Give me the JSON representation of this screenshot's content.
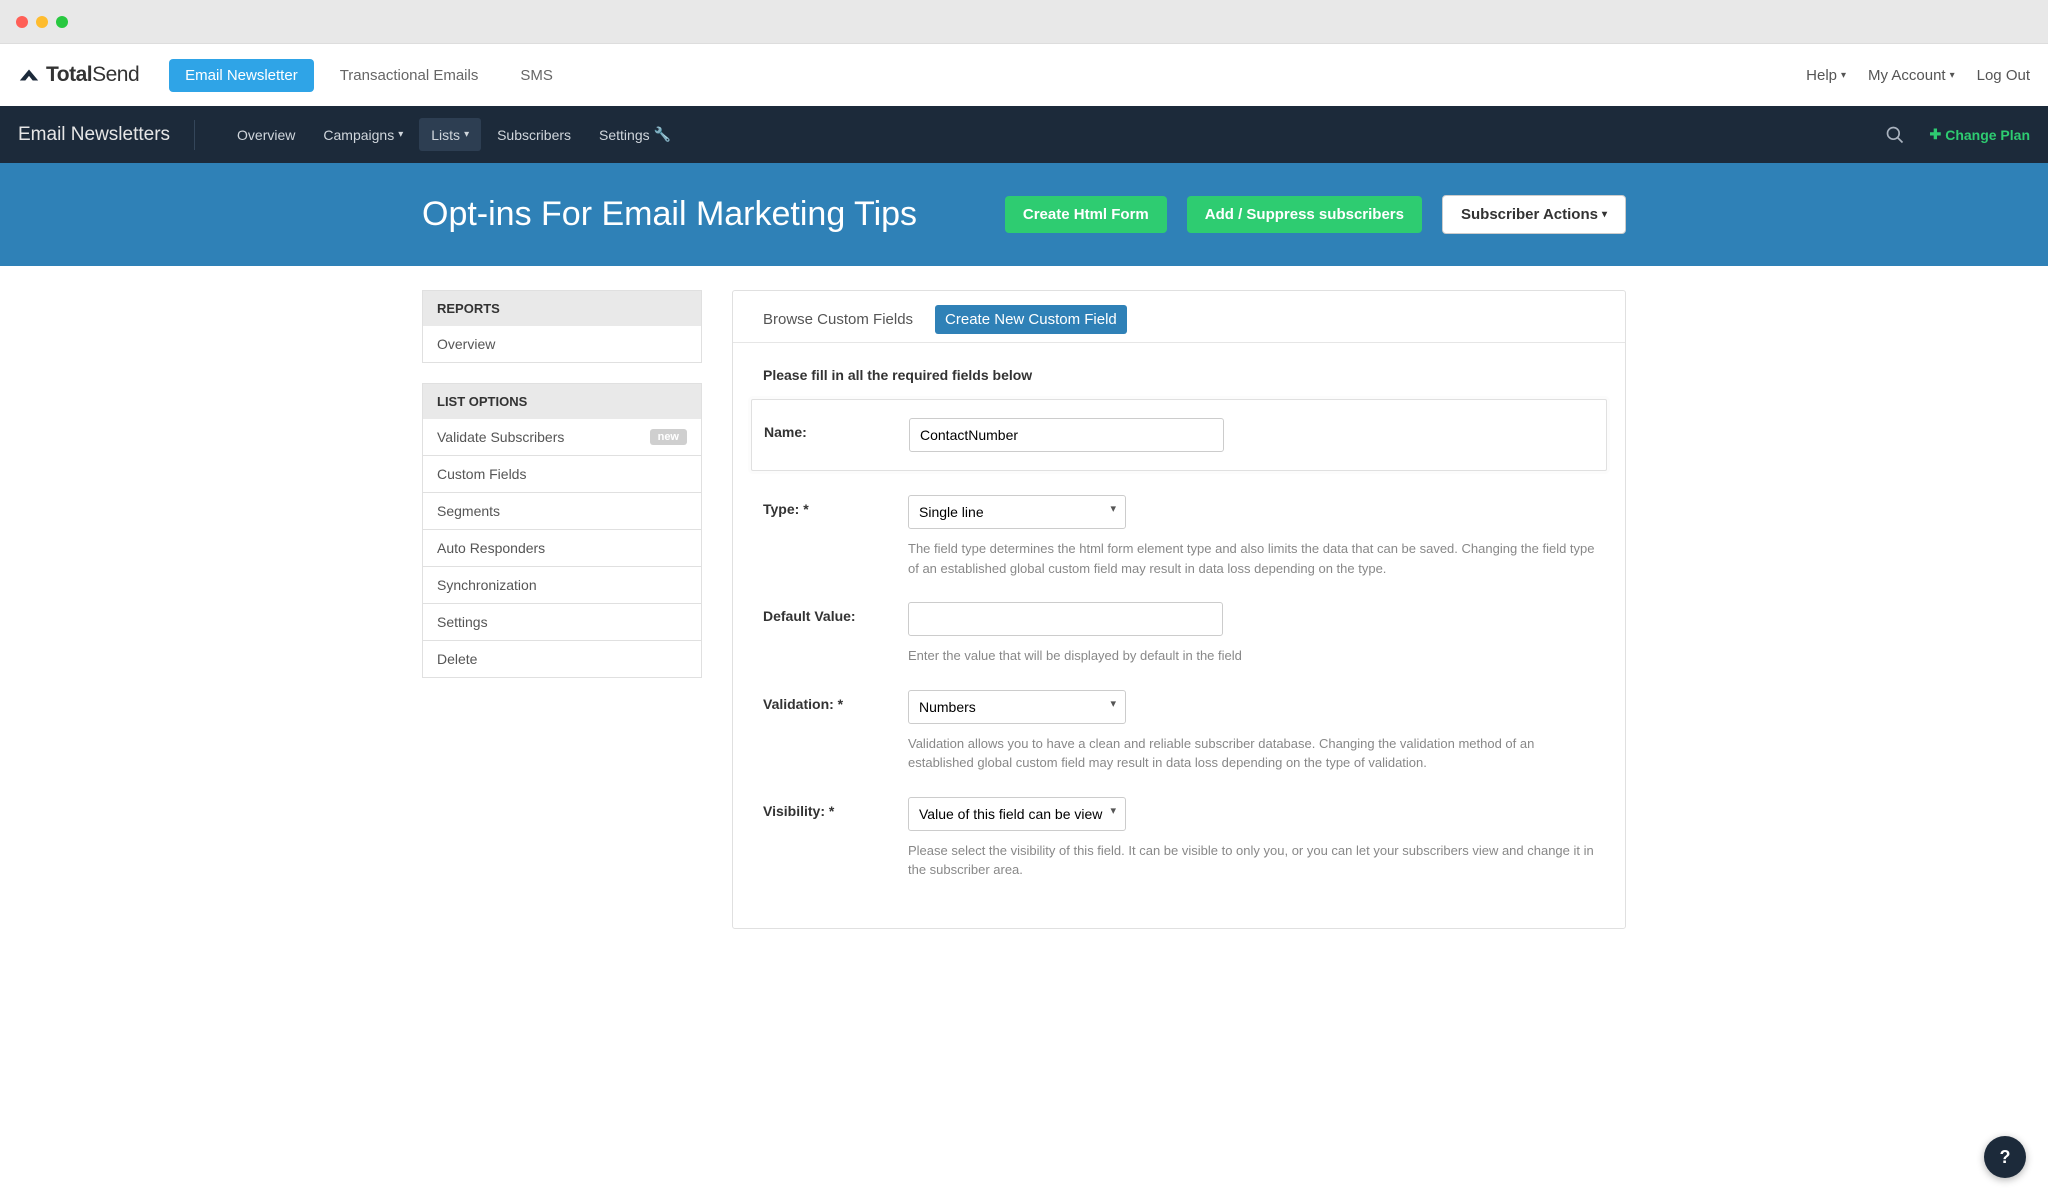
{
  "logo": {
    "bold": "Total",
    "light": "Send"
  },
  "topnav": {
    "tabs": [
      "Email Newsletter",
      "Transactional Emails",
      "SMS"
    ],
    "right": {
      "help": "Help",
      "account": "My Account",
      "logout": "Log Out"
    }
  },
  "subnav": {
    "title": "Email Newsletters",
    "items": [
      "Overview",
      "Campaigns",
      "Lists",
      "Subscribers",
      "Settings"
    ],
    "change_plan": "Change Plan"
  },
  "hero": {
    "title": "Opt-ins For Email Marketing Tips",
    "btn_create": "Create Html Form",
    "btn_add": "Add / Suppress subscribers",
    "btn_actions": "Subscriber Actions"
  },
  "sidebar": {
    "reports_header": "REPORTS",
    "reports": [
      "Overview"
    ],
    "options_header": "LIST OPTIONS",
    "options": [
      {
        "label": "Validate Subscribers",
        "badge": "new"
      },
      {
        "label": "Custom Fields"
      },
      {
        "label": "Segments"
      },
      {
        "label": "Auto Responders"
      },
      {
        "label": "Synchronization"
      },
      {
        "label": "Settings"
      },
      {
        "label": "Delete"
      }
    ]
  },
  "tabs": {
    "browse": "Browse Custom Fields",
    "create": "Create New Custom Field"
  },
  "form": {
    "intro": "Please fill in all the required fields below",
    "name_label": "Name:",
    "name_value": "ContactNumber",
    "type_label": "Type: *",
    "type_value": "Single line",
    "type_help": "The field type determines the html form element type and also limits the data that can be saved. Changing the field type of an established global custom field may result in data loss depending on the type.",
    "default_label": "Default Value:",
    "default_value": "",
    "default_help": "Enter the value that will be displayed by default in the field",
    "validation_label": "Validation: *",
    "validation_value": "Numbers",
    "validation_help": "Validation allows you to have a clean and reliable subscriber database. Changing the validation method of an established global custom field may result in data loss depending on the type of validation.",
    "visibility_label": "Visibility: *",
    "visibility_value": "Value of this field can be view",
    "visibility_help": "Please select the visibility of this field. It can be visible to only you, or you can let your subscribers view and change it in the subscriber area."
  },
  "help_bubble": "?"
}
